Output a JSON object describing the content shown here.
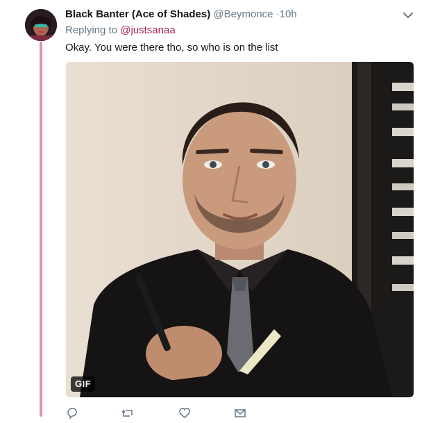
{
  "tweet": {
    "author_name": "Black Banter (Ace of Shades)",
    "author_handle": "@Beymonce",
    "separator": "·",
    "time": "10h",
    "replying_prefix": "Replying to",
    "replying_to": "@justsanaa",
    "text": "Okay. You were there tho, so who is on the list",
    "media_badge": "GIF"
  },
  "colors": {
    "thread_line": "#dd96ac",
    "mention": "#a8244f",
    "secondary_text": "#657786"
  },
  "icons": {
    "caret": "chevron-down-icon",
    "reply": "reply-icon",
    "retweet": "retweet-icon",
    "like": "heart-icon",
    "dm": "envelope-icon"
  }
}
